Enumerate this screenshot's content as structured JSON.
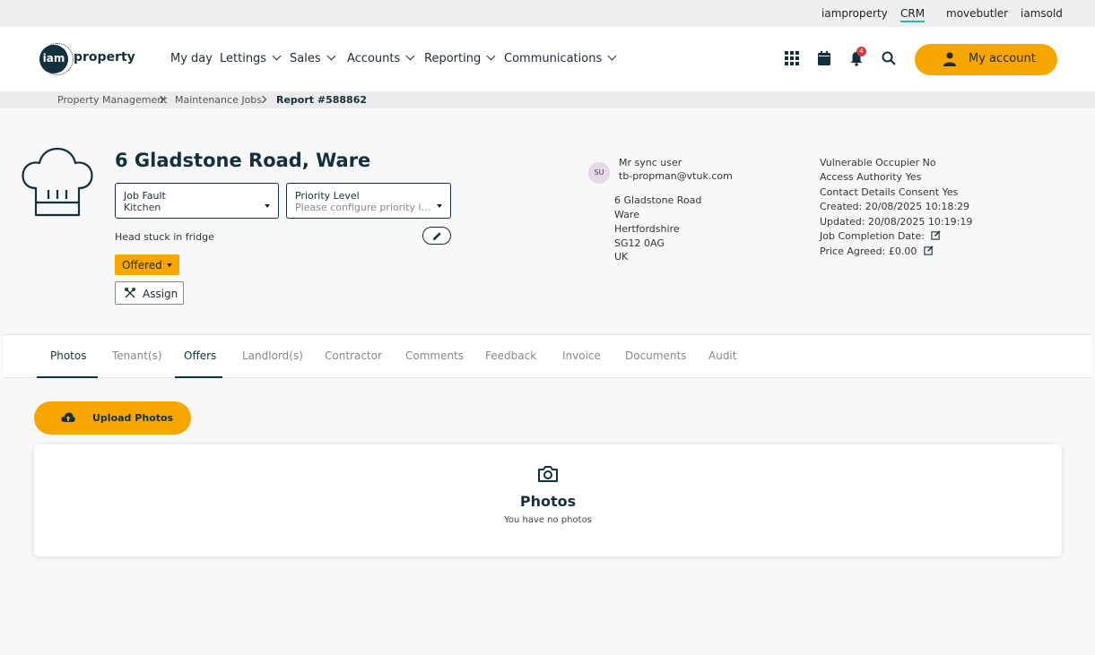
{
  "top_links": [
    "iamproperty",
    "CRM",
    "movebutler",
    "iamsold"
  ],
  "top_active": "CRM",
  "logo": {
    "circle_text": "iam",
    "word": "property"
  },
  "nav": [
    "My day",
    "Lettings",
    "Sales",
    "Accounts",
    "Reporting",
    "Communications"
  ],
  "notification_count": "4",
  "account_label": "My account",
  "breadcrumb": [
    "Property Management",
    "Maintenance Jobs",
    "Report #588862"
  ],
  "job": {
    "title": "6 Gladstone Road, Ware",
    "fault_label": "Job Fault",
    "fault_value": "Kitchen",
    "priority_label": "Priority Level",
    "priority_placeholder": "Please configure priority levels first",
    "description": "Head stuck in fridge",
    "status": "Offered",
    "assign_label": "Assign"
  },
  "tenant": {
    "initials": "SU",
    "name": "Mr sync user",
    "email": "tb-propman@vtuk.com",
    "address": [
      "6 Gladstone Road",
      "Ware",
      "Hertfordshire",
      "SG12 0AG",
      "UK"
    ]
  },
  "meta": [
    "Vulnerable Occupier No",
    "Access Authority Yes",
    "Contact Details Consent Yes",
    "Created: 20/08/2025 10:18:29",
    "Updated: 20/08/2025 10:19:19",
    "Job Completion Date:",
    "Price Agreed: £0.00"
  ],
  "tabs": [
    "Photos",
    "Tenant(s)",
    "Offers",
    "Landlord(s)",
    "Contractor",
    "Comments",
    "Feedback",
    "Invoice",
    "Documents",
    "Audit"
  ],
  "upload_label": "Upload Photos",
  "photos_card": {
    "title": "Photos",
    "subtitle": "You have no photos"
  },
  "colors": {
    "accent": "#f7a600",
    "navy": "#13303e",
    "teal": "#2bb3a6"
  }
}
